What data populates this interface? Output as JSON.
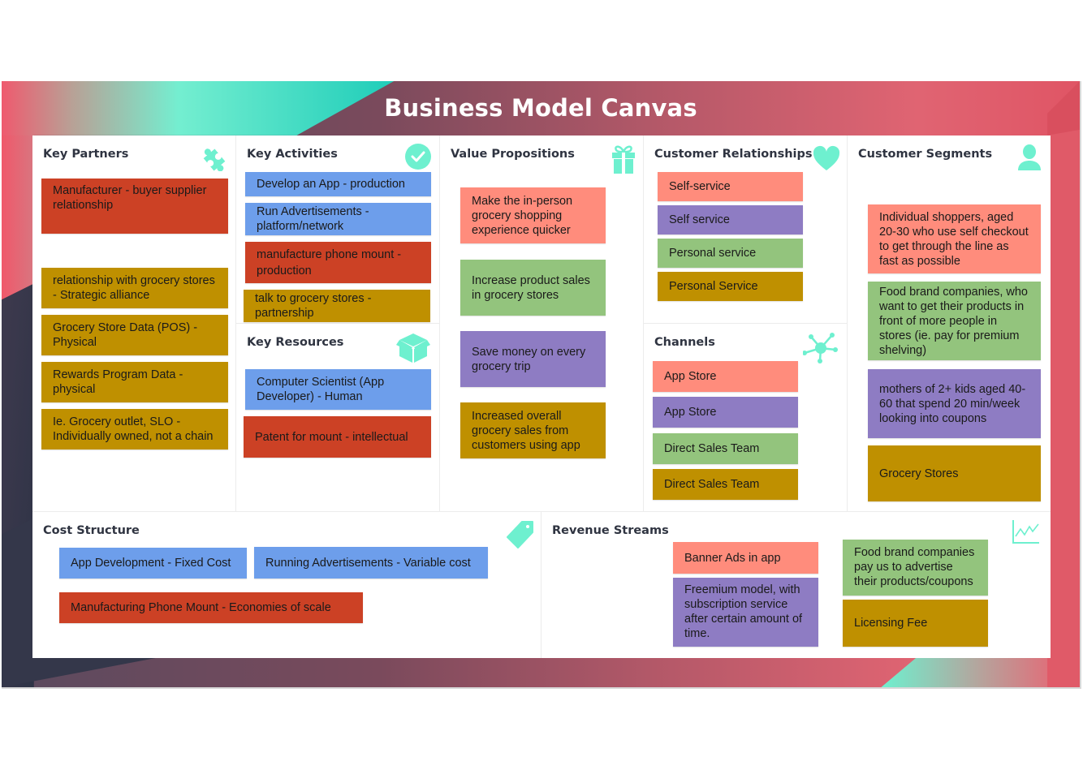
{
  "title": "Business Model Canvas",
  "accent_color": "#6ef0cf",
  "note_colors": {
    "red": "#cc4125",
    "gold": "#bf9000",
    "blue": "#6d9eeb",
    "salmon": "#ff8c7c",
    "green": "#93c47d",
    "purple": "#8e7cc3"
  },
  "sections": {
    "key_partners": {
      "title": "Key Partners",
      "icon": "puzzle-icon",
      "notes": [
        {
          "text": "Manufacturer - buyer supplier relationship",
          "color": "red"
        },
        {
          "text": "relationship with grocery stores - Strategic alliance",
          "color": "gold"
        },
        {
          "text": "Grocery Store Data (POS) - Physical",
          "color": "gold"
        },
        {
          "text": "Rewards Program Data - physical",
          "color": "gold"
        },
        {
          "text": "Ie. Grocery outlet, SLO - Individually owned, not a chain",
          "color": "gold"
        }
      ]
    },
    "key_activities": {
      "title": "Key Activities",
      "icon": "check-circle-icon",
      "notes": [
        {
          "text": "Develop an App - production",
          "color": "blue"
        },
        {
          "text": "Run Advertisements - platform/network",
          "color": "blue"
        },
        {
          "text": "manufacture phone mount - production",
          "color": "red"
        },
        {
          "text": "talk to grocery stores - partnership",
          "color": "gold"
        }
      ]
    },
    "key_resources": {
      "title": "Key Resources",
      "icon": "box-icon",
      "notes": [
        {
          "text": "Computer Scientist (App Developer) - Human",
          "color": "blue"
        },
        {
          "text": "Patent for mount - intellectual",
          "color": "red"
        }
      ]
    },
    "value_propositions": {
      "title": "Value Propositions",
      "icon": "gift-icon",
      "notes": [
        {
          "text": "Make the in-person grocery shopping experience quicker",
          "color": "salmon"
        },
        {
          "text": "Increase product sales in grocery stores",
          "color": "green"
        },
        {
          "text": "Save money on every grocery trip",
          "color": "purple"
        },
        {
          "text": "Increased overall grocery sales from customers using app",
          "color": "gold"
        }
      ]
    },
    "customer_relationships": {
      "title": "Customer Relationships",
      "icon": "heart-icon",
      "notes": [
        {
          "text": "Self-service",
          "color": "salmon"
        },
        {
          "text": "Self service",
          "color": "purple"
        },
        {
          "text": "Personal service",
          "color": "green"
        },
        {
          "text": "Personal Service",
          "color": "gold"
        }
      ]
    },
    "channels": {
      "title": "Channels",
      "icon": "network-icon",
      "notes": [
        {
          "text": "App Store",
          "color": "salmon"
        },
        {
          "text": "App Store",
          "color": "purple"
        },
        {
          "text": "Direct Sales Team",
          "color": "green"
        },
        {
          "text": "Direct Sales Team",
          "color": "gold"
        }
      ]
    },
    "customer_segments": {
      "title": "Customer Segments",
      "icon": "user-icon",
      "notes": [
        {
          "text": "Individual shoppers, aged 20-30 who use self checkout to get through the line as fast as possible",
          "color": "salmon"
        },
        {
          "text": "Food brand companies, who want to get their products in front of more people in stores (ie. pay for premium shelving)",
          "color": "green"
        },
        {
          "text": "mothers of 2+ kids aged 40-60 that spend 20 min/week looking into coupons",
          "color": "purple"
        },
        {
          "text": "Grocery Stores",
          "color": "gold"
        }
      ]
    },
    "cost_structure": {
      "title": "Cost Structure",
      "icon": "tag-icon",
      "notes": [
        {
          "text": "App Development - Fixed Cost",
          "color": "blue"
        },
        {
          "text": "Running Advertisements - Variable cost",
          "color": "blue"
        },
        {
          "text": "Manufacturing Phone Mount - Economies of scale",
          "color": "red"
        }
      ]
    },
    "revenue_streams": {
      "title": "Revenue Streams",
      "icon": "line-chart-icon",
      "notes": [
        {
          "text": "Banner Ads in app",
          "color": "salmon"
        },
        {
          "text": "Freemium model, with subscription service after certain amount of time.",
          "color": "purple"
        },
        {
          "text": "Food brand companies pay us to advertise their products/coupons",
          "color": "green"
        },
        {
          "text": "Licensing Fee",
          "color": "gold"
        }
      ]
    }
  }
}
